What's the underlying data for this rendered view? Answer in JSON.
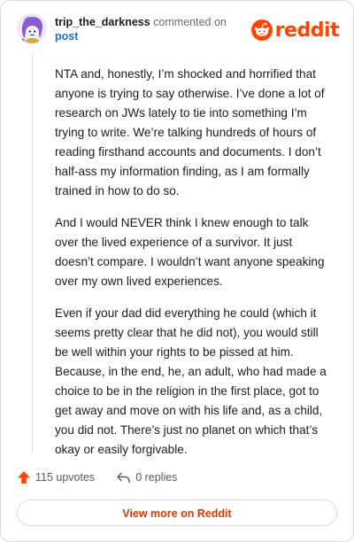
{
  "header": {
    "username": "trip_the_darkness",
    "commented_text": " commented on",
    "post_link": "post",
    "brand_wordmark": "reddit",
    "brand_color": "#ff4500"
  },
  "avatar": {
    "icon": "snoo-avatar-icon",
    "color": "#8a5bd6"
  },
  "comment": {
    "paragraphs": [
      "NTA and, honestly, I’m shocked and horrified that anyone is trying to say otherwise. I’ve done a lot of research on JWs lately to tie into something I’m trying to write. We’re talking hundreds of hours of reading firsthand accounts and documents. I don’t half-ass my information finding, as I am formally trained in how to do so.",
      "And I would NEVER think I knew enough to talk over the lived experience of a survivor. It just doesn’t compare. I wouldn’t want anyone speaking over my own lived experiences.",
      "Even if your dad did everything he could (which it seems pretty clear that he did not), you would still be well within your rights to be pissed at him. Because, in the end, he, an adult, who had made a choice to be in the religion in the first place, got to get away and move on with his life and, as a child, you did not. There’s just no planet on which that’s okay or easily forgivable."
    ]
  },
  "actions": {
    "upvotes_label": "115 upvotes",
    "upvote_icon": "upvote-arrow-icon",
    "upvote_color": "#ff4500",
    "replies_label": "0 replies",
    "reply_icon": "reply-arrow-icon"
  },
  "footer": {
    "view_more_label": "View more on Reddit"
  }
}
